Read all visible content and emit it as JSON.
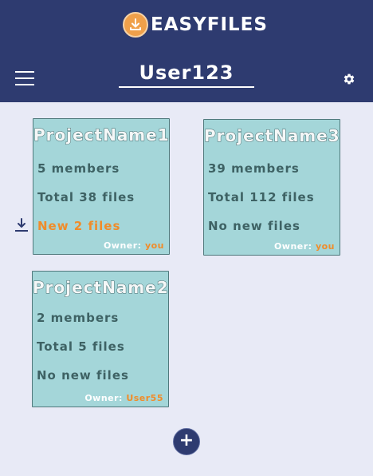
{
  "app": {
    "brand": "EASYFILES",
    "accent_color": "#f0a04a",
    "header_color": "#2e3b70"
  },
  "header": {
    "username": "User123",
    "menu_icon": "hamburger-menu-icon",
    "settings_icon": "gear-icon"
  },
  "projects": [
    {
      "title": "ProjectName1",
      "members": "5 members",
      "total": "Total 38 files",
      "status": "New 2 files",
      "has_new": true,
      "owner_label": "Owner:",
      "owner": "you"
    },
    {
      "title": "ProjectName3",
      "members": "39 members",
      "total": "Total 112 files",
      "status": "No new files",
      "has_new": false,
      "owner_label": "Owner:",
      "owner": "you"
    },
    {
      "title": "ProjectName2",
      "members": "2 members",
      "total": "Total 5 files",
      "status": "No new files",
      "has_new": false,
      "owner_label": "Owner:",
      "owner": "User55"
    }
  ],
  "actions": {
    "add_label": "+",
    "download_icon": "download-icon"
  }
}
